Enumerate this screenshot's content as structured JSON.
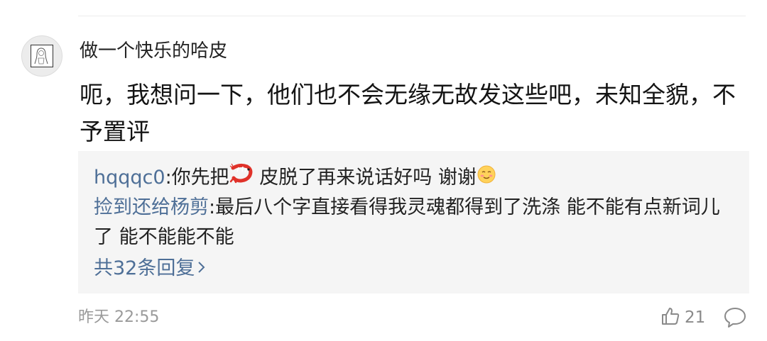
{
  "comment": {
    "username": "做一个快乐的哈皮",
    "body": "呃，我想问一下，他们也不会无缘无故发这些吧，未知全貌，不予置评",
    "timestamp": "昨天 22:55",
    "like_count": "21"
  },
  "replies": [
    {
      "user": "hqqqc0",
      "separator": ":",
      "text_before": "你先把",
      "emoji1": "shrimp-emoji",
      "text_after": " 皮脱了再来说话好吗 谢谢",
      "emoji2": "blush-emoji"
    },
    {
      "user": "捡到还给杨剪",
      "separator": ":",
      "text": "最后八个字直接看得我灵魂都得到了洗涤 能不能有点新词儿了 能不能能不能"
    }
  ],
  "more_replies_label": "共32条回复",
  "colors": {
    "link": "#4e6f97",
    "reply_bg": "#f5f5f5",
    "meta": "#9a9a9a"
  }
}
